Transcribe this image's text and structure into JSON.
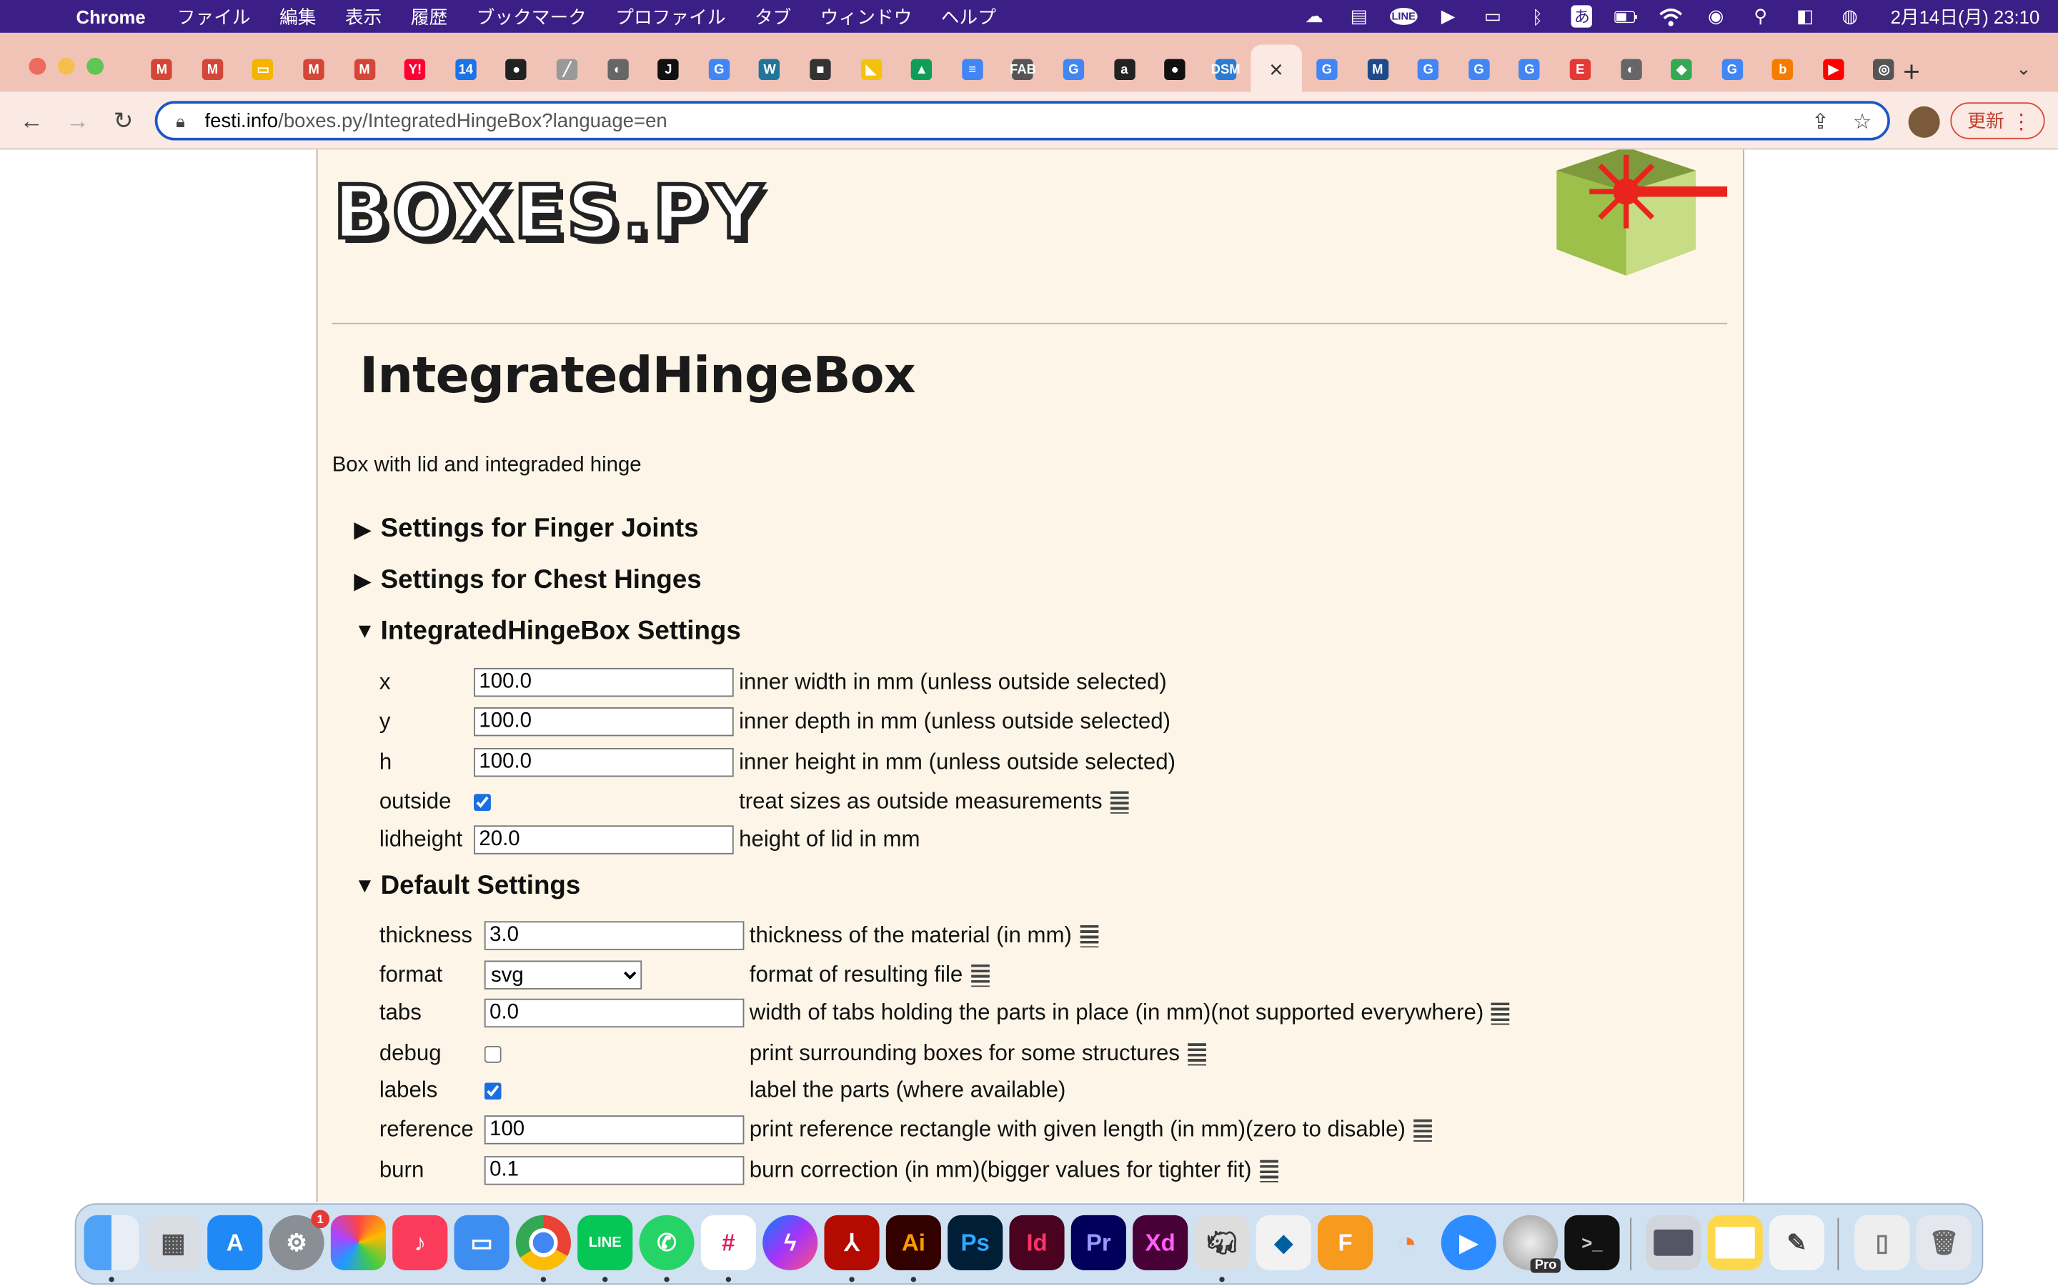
{
  "menubar": {
    "app_name": "Chrome",
    "menus": [
      "ファイル",
      "編集",
      "表示",
      "履歴",
      "ブックマーク",
      "プロファイル",
      "タブ",
      "ウィンドウ",
      "ヘルプ"
    ],
    "clock": "2月14日(月) 23:10",
    "line_label": "LINE",
    "input_method": "あ"
  },
  "browser": {
    "url_host": "festi.info",
    "url_path": "/boxes.py/IntegratedHingeBox?language=en",
    "update_label": "更新",
    "tab_favicons": [
      "M",
      "M",
      "▭",
      "M",
      "M",
      "Y!",
      "14",
      "●",
      "╱",
      "◐",
      "J",
      "G",
      "W",
      "■",
      "◣",
      "▲",
      "≡",
      "FAB",
      "G",
      "a",
      "●",
      "DSM",
      "×",
      "G",
      "M",
      "G",
      "G",
      "G",
      "E",
      "◐",
      "◆",
      "G",
      "b",
      "▶",
      "◎"
    ]
  },
  "page": {
    "logo_text": "BOXES.PY",
    "title": "IntegratedHingeBox",
    "description": "Box with lid and integraded hinge",
    "sections": {
      "finger": "Settings for Finger Joints",
      "chest": "Settings for Chest Hinges",
      "ihb": "IntegratedHingeBox Settings",
      "defaults": "Default Settings"
    },
    "arrows": {
      "collapsed": "▶",
      "expanded": "▼"
    },
    "ihb": {
      "x": {
        "label": "x",
        "value": "100.0",
        "help": "inner width in mm (unless outside selected)"
      },
      "y": {
        "label": "y",
        "value": "100.0",
        "help": "inner depth in mm (unless outside selected)"
      },
      "h": {
        "label": "h",
        "value": "100.0",
        "help": "inner height in mm (unless outside selected)"
      },
      "outside": {
        "label": "outside",
        "checked": true,
        "help": "treat sizes as outside measurements"
      },
      "lidheight": {
        "label": "lidheight",
        "value": "20.0",
        "help": "height of lid in mm"
      }
    },
    "defaults": {
      "thickness": {
        "label": "thickness",
        "value": "3.0",
        "help": "thickness of the material (in mm)"
      },
      "format": {
        "label": "format",
        "value": "svg",
        "help": "format of resulting file"
      },
      "tabs": {
        "label": "tabs",
        "value": "0.0",
        "help": "width of tabs holding the parts in place (in mm)(not supported everywhere)"
      },
      "debug": {
        "label": "debug",
        "checked": false,
        "help": "print surrounding boxes for some structures"
      },
      "labels": {
        "label": "labels",
        "checked": true,
        "help": "label the parts (where available)"
      },
      "reference": {
        "label": "reference",
        "value": "100",
        "help": "print reference rectangle with given length (in mm)(zero to disable)"
      },
      "burn": {
        "label": "burn",
        "value": "0.1",
        "help": "burn correction (in mm)(bigger values for tighter fit)"
      }
    }
  },
  "dock": {
    "apps": [
      "Finder",
      "Launchpad",
      "App Store",
      "System Preferences",
      "Photos",
      "Music",
      "Keynote",
      "Chrome",
      "LINE",
      "WhatsApp",
      "Slack",
      "Messenger",
      "Acrobat",
      "Illustrator",
      "Photoshop",
      "InDesign",
      "Premiere Pro",
      "Adobe XD",
      "Rhinoceros",
      "SketchUp",
      "Fusion 360",
      "Blender",
      "Zoom",
      "Google Earth Pro",
      "Terminal"
    ],
    "labels": {
      "illustrator": "Ai",
      "photoshop": "Ps",
      "indesign": "Id",
      "premiere": "Pr",
      "xd": "Xd",
      "fusion": "F",
      "pro": "Pro"
    },
    "settings_badge": "1"
  }
}
